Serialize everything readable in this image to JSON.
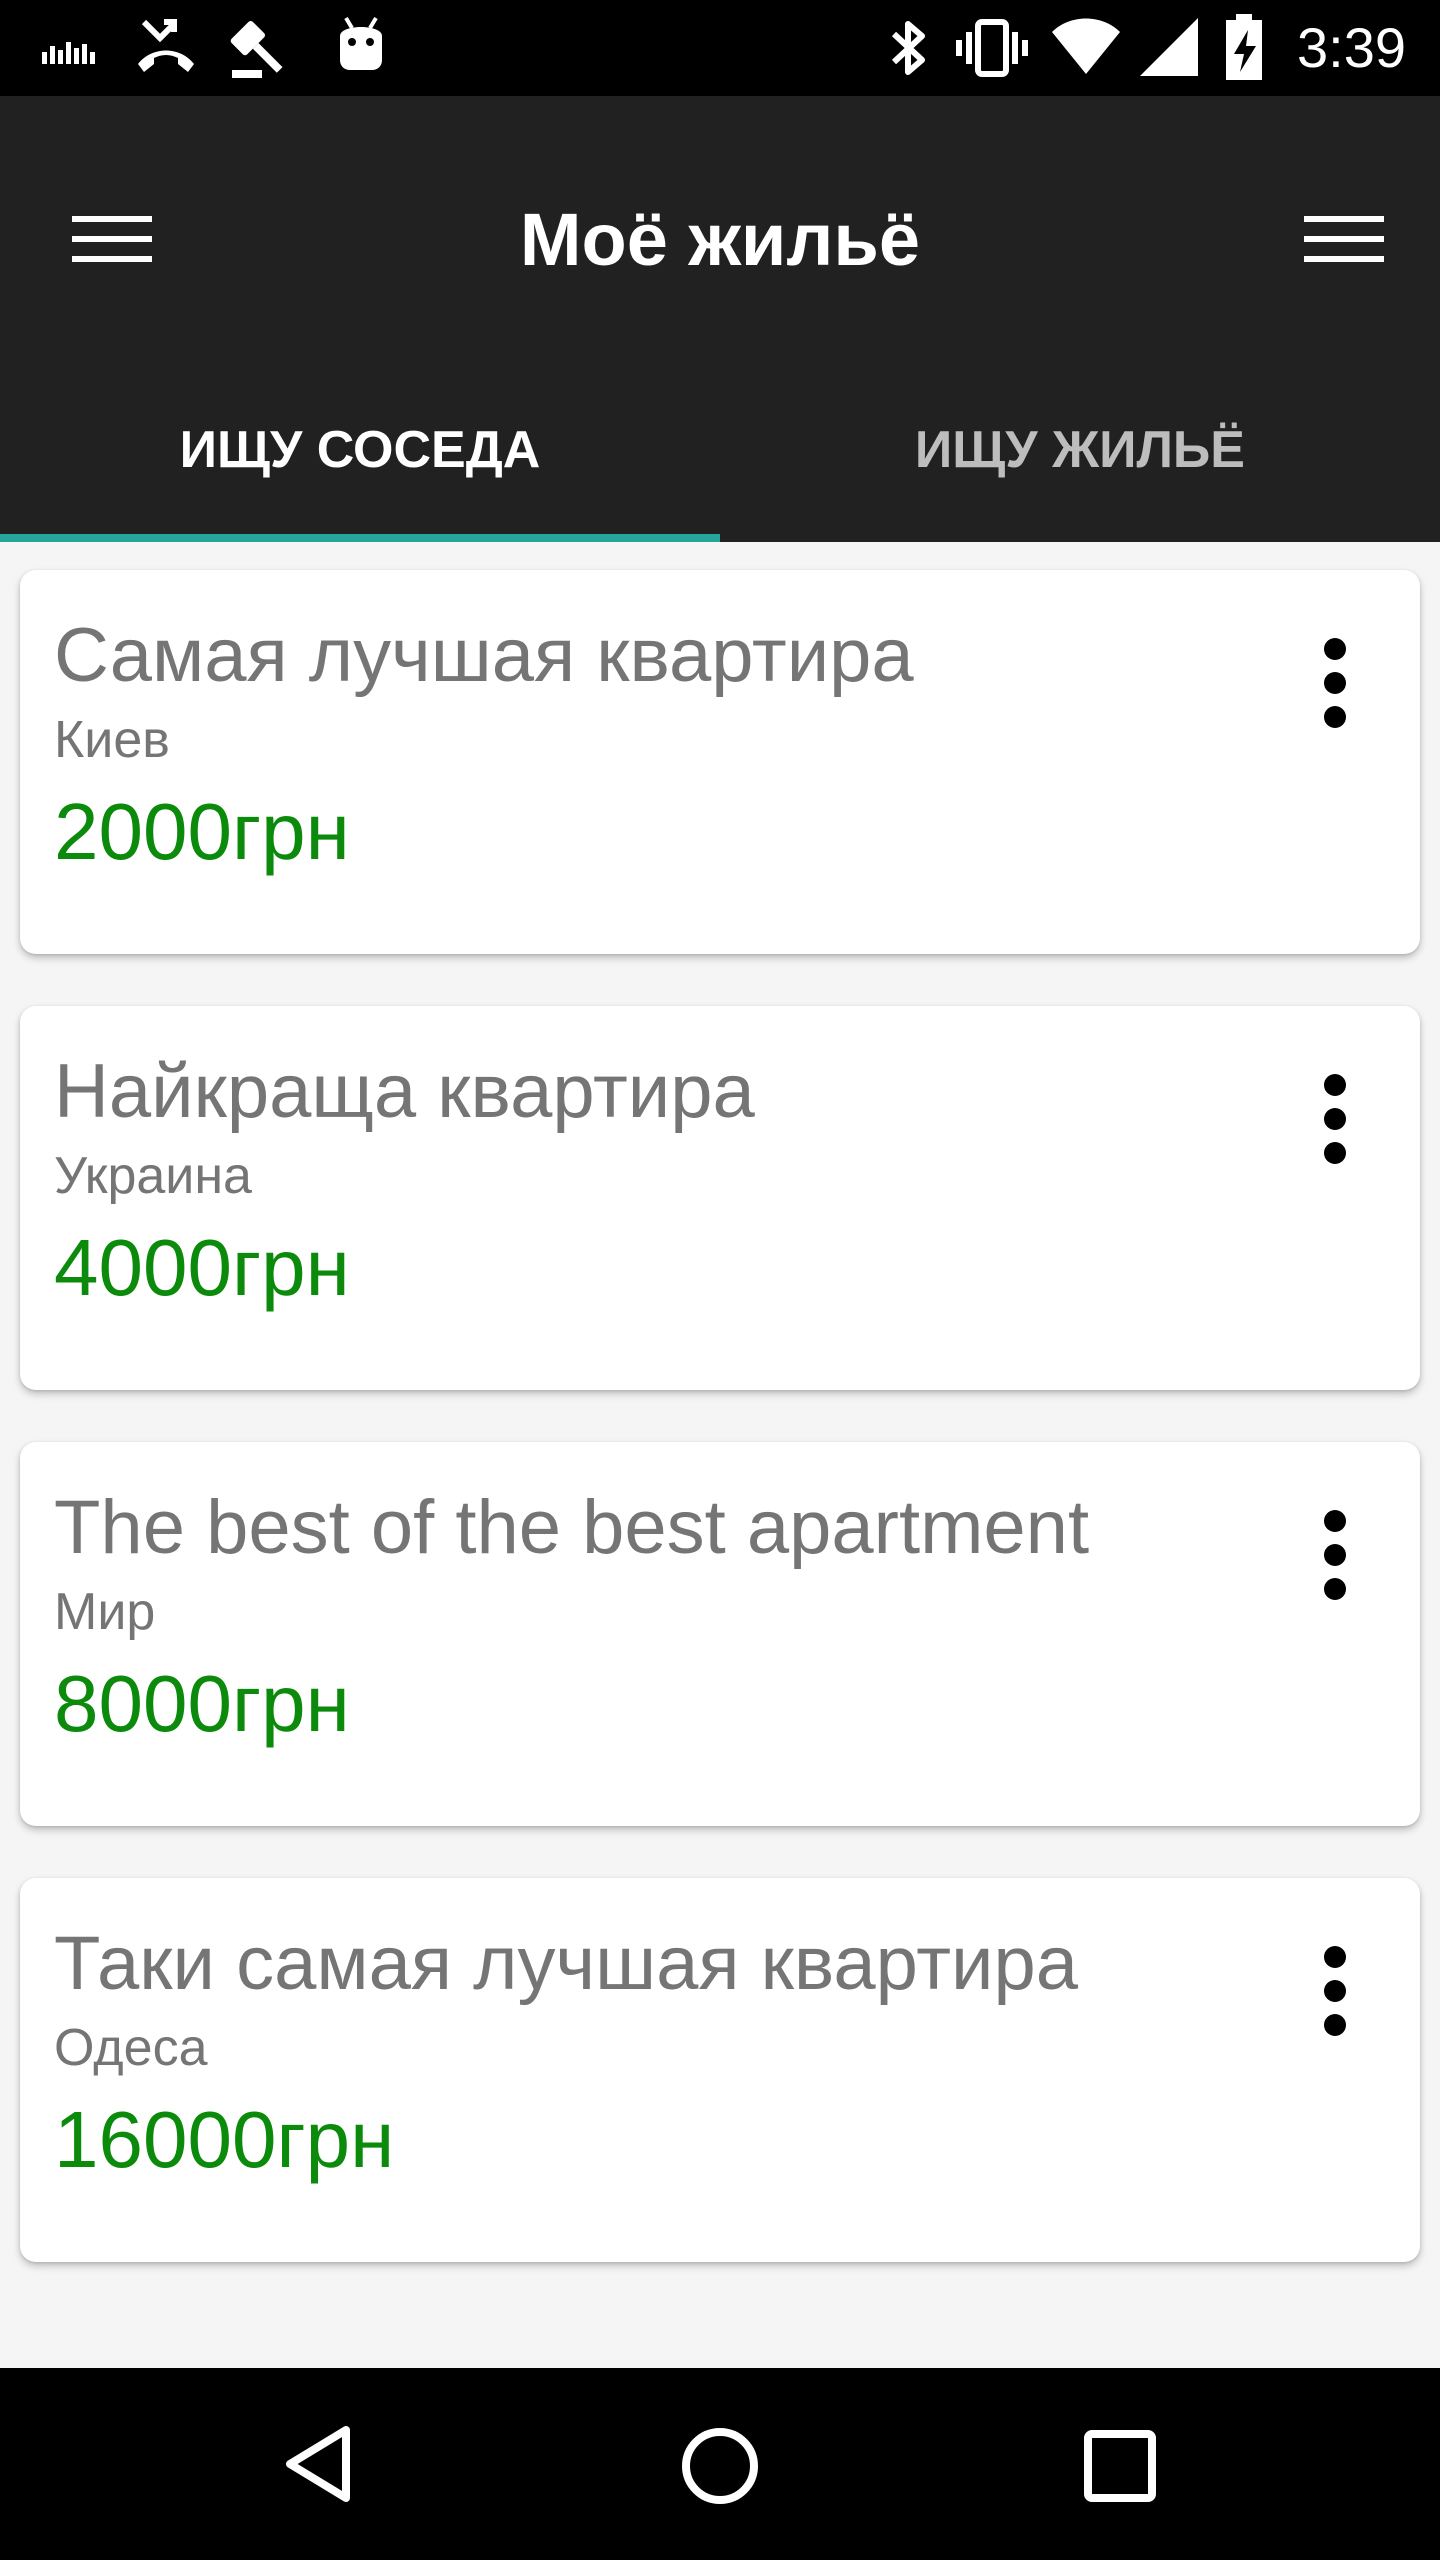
{
  "status_bar": {
    "time": "3:39",
    "left_icons": [
      "equalizer-icon",
      "missed-call-icon",
      "gavel-icon",
      "android-icon"
    ],
    "right_icons": [
      "bluetooth-icon",
      "vibrate-icon",
      "wifi-icon",
      "cell-signal-icon",
      "battery-charging-icon"
    ]
  },
  "app_bar": {
    "title": "Моё жильё",
    "left_icon": "menu-icon",
    "right_icon": "menu-icon",
    "background": "#212121"
  },
  "tabs": [
    {
      "label": "ИЩУ СОСЕДА",
      "active": true
    },
    {
      "label": "ИЩУ ЖИЛЬЁ",
      "active": false
    }
  ],
  "accent_color": "#26a69a",
  "price_color": "#0b8a0b",
  "listings": [
    {
      "title": "Самая лучшая квартира",
      "location": "Киев",
      "price": "2000грн"
    },
    {
      "title": "Найкраща квартира",
      "location": "Украина",
      "price": "4000грн"
    },
    {
      "title": "The best of the best apartment",
      "location": "Мир",
      "price": "8000грн"
    },
    {
      "title": "Таки самая лучшая квартира",
      "location": "Одеса",
      "price": "16000грн"
    }
  ],
  "nav_bar": {
    "icons": [
      "back-icon",
      "home-icon",
      "recents-icon"
    ]
  }
}
